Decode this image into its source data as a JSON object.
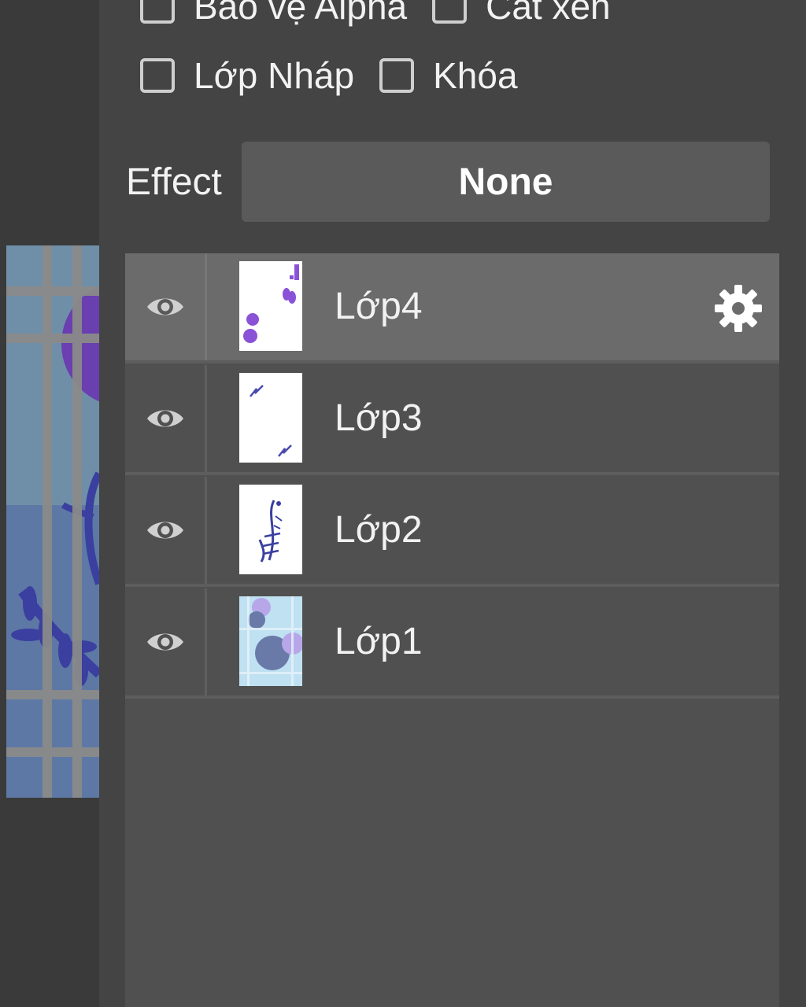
{
  "options": {
    "alpha_protect_label": "Bảo vệ Alpha",
    "clipping_label": "Cắt xén",
    "draft_layer_label": "Lớp Nháp",
    "lock_label": "Khóa"
  },
  "effect": {
    "label": "Effect",
    "value": "None"
  },
  "layers": [
    {
      "name": "Lớp4",
      "visible": true,
      "selected": true
    },
    {
      "name": "Lớp3",
      "visible": true,
      "selected": false
    },
    {
      "name": "Lớp2",
      "visible": true,
      "selected": false
    },
    {
      "name": "Lớp1",
      "visible": true,
      "selected": false
    }
  ],
  "icons": {
    "visibility": "eye-icon",
    "settings": "gear-icon"
  },
  "colors": {
    "panel": "#444444",
    "layer_list": "#505050",
    "selected_row": "#6b6b6b",
    "effect_button": "#5a5a5a",
    "artwork_purple": "#6a3fb0",
    "artwork_blue": "#3a3fa0"
  }
}
